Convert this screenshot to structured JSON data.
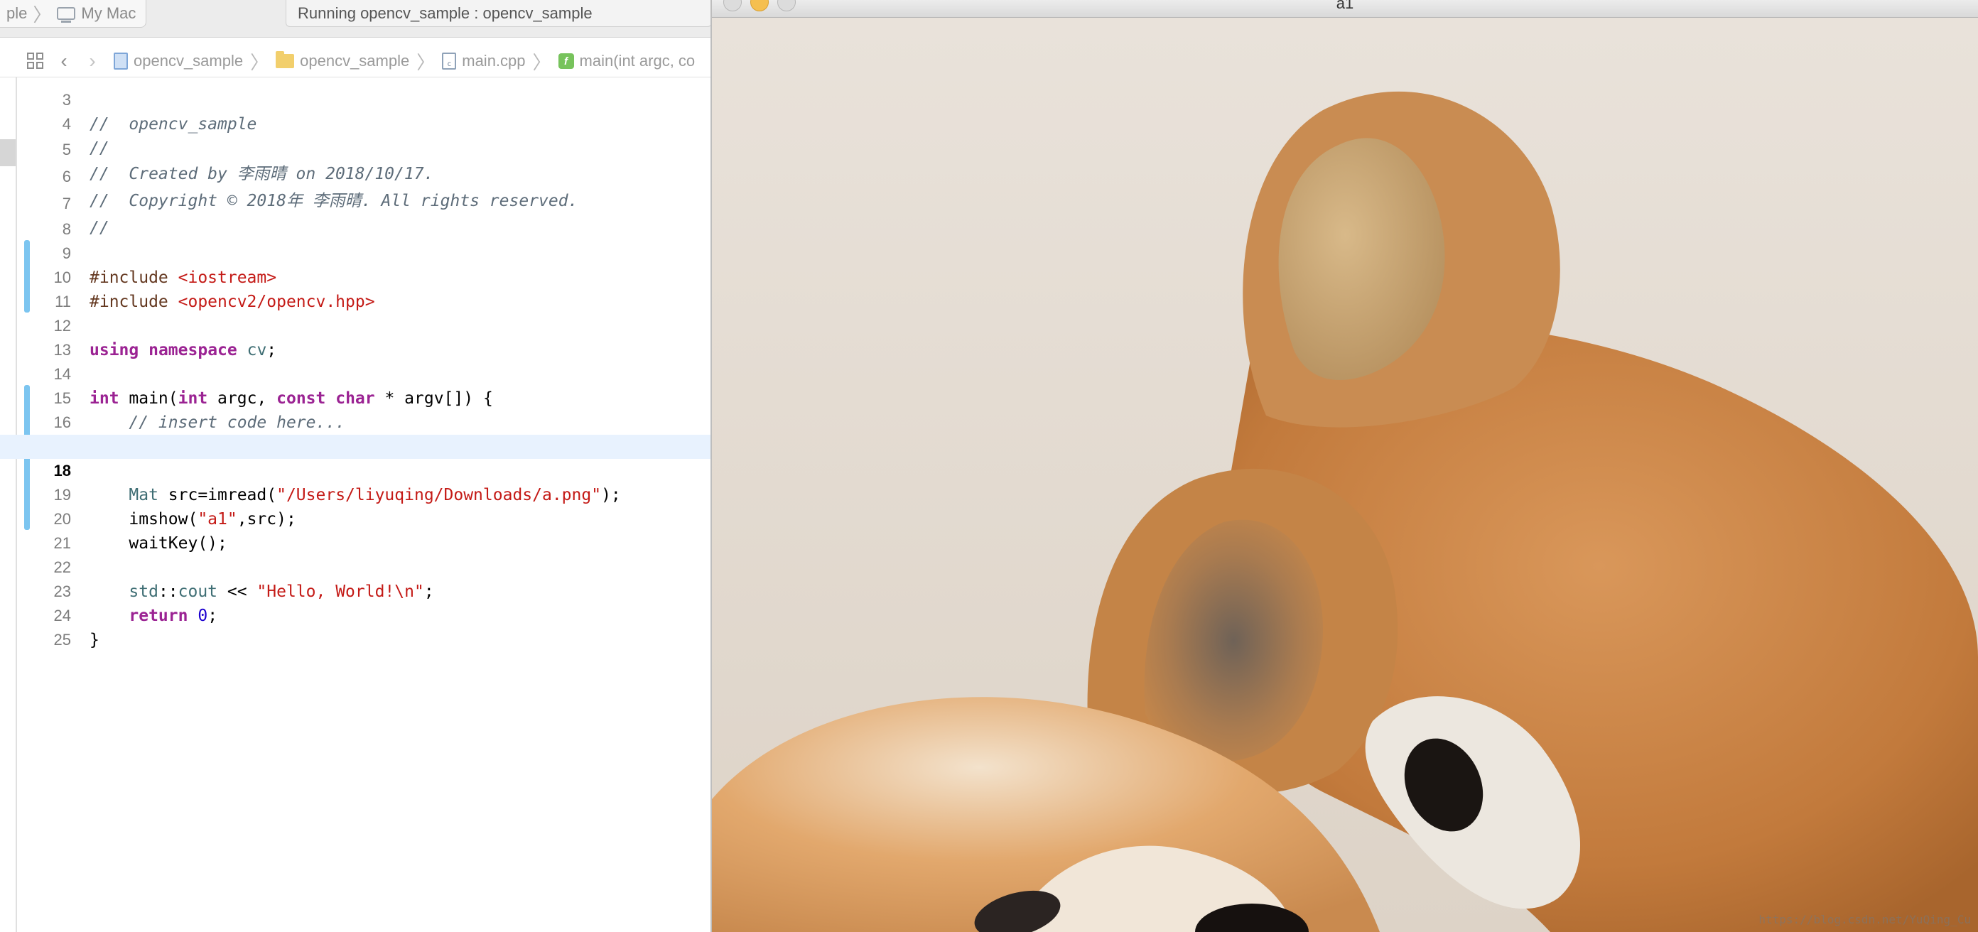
{
  "toolbar": {
    "scheme_target": "ple",
    "destination": "My Mac",
    "activity_status": "Running opencv_sample : opencv_sample"
  },
  "jumpbar": {
    "project": "opencv_sample",
    "group": "opencv_sample",
    "file": "main.cpp",
    "symbol": "main(int argc, co"
  },
  "editor": {
    "current_line": "18",
    "lines": [
      {
        "n": "3",
        "text": "//  opencv_sample"
      },
      {
        "n": "4",
        "text": "//"
      },
      {
        "n": "5",
        "text": "//  Created by 李雨晴 on 2018/10/17."
      },
      {
        "n": "6",
        "text": "//  Copyright © 2018年 李雨晴. All rights reserved."
      },
      {
        "n": "7",
        "text": "//"
      },
      {
        "n": "8",
        "text": ""
      },
      {
        "n": "9",
        "pre": "#include ",
        "str": "<iostream>"
      },
      {
        "n": "10",
        "pre": "#include ",
        "str": "<opencv2/opencv.hpp>"
      },
      {
        "n": "11",
        "text": ""
      },
      {
        "n": "12",
        "kw1": "using",
        "kw2": "namespace",
        "ns": "cv",
        "end": ";"
      },
      {
        "n": "13",
        "text": ""
      },
      {
        "n": "14",
        "kw_int": "int",
        "fn": " main(",
        "kw_int2": "int",
        "a1": " argc, ",
        "kw_const": "const",
        "sp": " ",
        "kw_char": "char",
        "rest": " * argv[]) {"
      },
      {
        "n": "15",
        "text": "    // insert code here..."
      },
      {
        "n": "16",
        "text": ""
      },
      {
        "n": "17",
        "text": ""
      },
      {
        "n": "18",
        "type": "Mat",
        "mid": " src=imread(",
        "str": "\"/Users/liyuqing/Downloads/a.png\"",
        "end": ");"
      },
      {
        "n": "19",
        "fn": "imshow(",
        "str": "\"a1\"",
        "end": ",src);"
      },
      {
        "n": "20",
        "fn": "waitKey",
        "end": "();"
      },
      {
        "n": "21",
        "text": ""
      },
      {
        "n": "22",
        "ns": "std",
        "sep": "::",
        "type": "cout",
        "mid": " << ",
        "str": "\"Hello, World!\\n\"",
        "end": ";"
      },
      {
        "n": "23",
        "kw": "return",
        "sp": " ",
        "num": "0",
        "end": ";"
      },
      {
        "n": "24",
        "text": "}"
      },
      {
        "n": "25",
        "text": ""
      }
    ]
  },
  "image_window": {
    "title": "a1",
    "watermark": "https://blog.csdn.net/YuQing_Cu"
  },
  "colors": {
    "comment": "#5d6c79",
    "keyword": "#9b2393",
    "string": "#c41a16",
    "type": "#3f6e74",
    "number": "#1c00cf",
    "preprocessor": "#643820",
    "change_bar": "#7cc5f0",
    "current_line_bg": "#e8f2fe"
  }
}
